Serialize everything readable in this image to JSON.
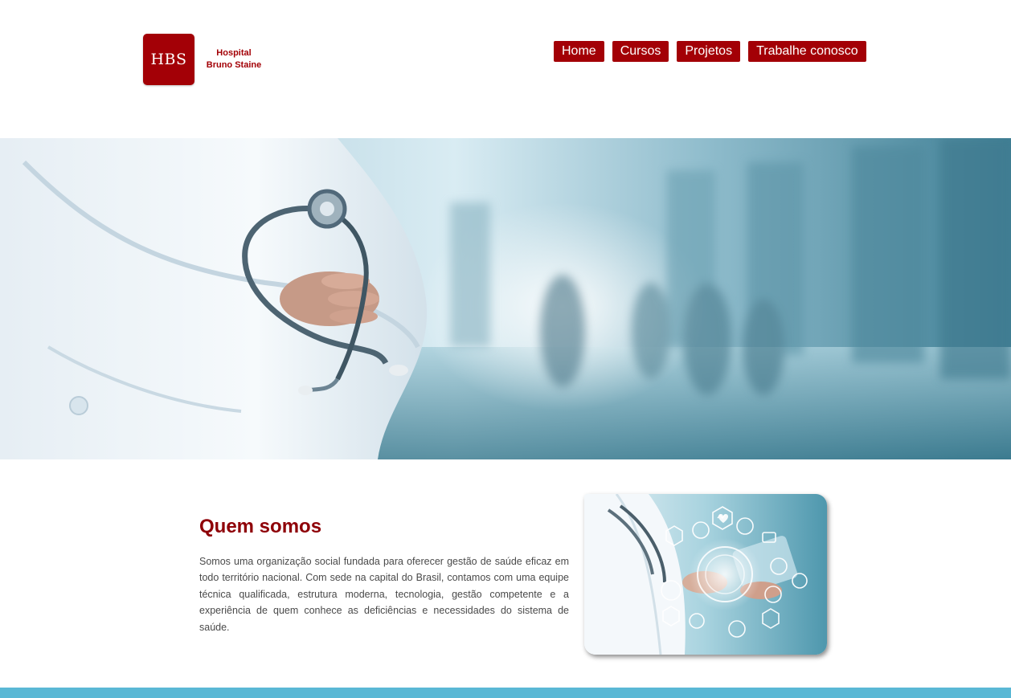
{
  "brand": {
    "logo_initials": "HBS",
    "name_line1": "Hospital",
    "name_line2": "Bruno Staine",
    "color": "#a30006"
  },
  "nav": {
    "items": [
      {
        "label": "Home"
      },
      {
        "label": "Cursos"
      },
      {
        "label": "Projetos"
      },
      {
        "label": "Trabalhe conosco"
      }
    ]
  },
  "hero": {
    "image_subject": "doctor-with-stethoscope-hospital-corridor"
  },
  "about": {
    "title": "Quem somos",
    "text": "Somos uma organização social fundada para oferecer gestão de saúde eficaz em todo território nacional. Com sede na capital do Brasil, contamos com uma equipe técnica qualificada, estrutura moderna, tecnologia, gestão competente e a experiência de quem conhece as deficiências e necessidades do sistema de saúde.",
    "image_subject": "doctor-tablet-medical-icons"
  },
  "colors": {
    "accent": "#a30006",
    "title": "#8e0007",
    "footer_strip": "#5ab8d5"
  }
}
